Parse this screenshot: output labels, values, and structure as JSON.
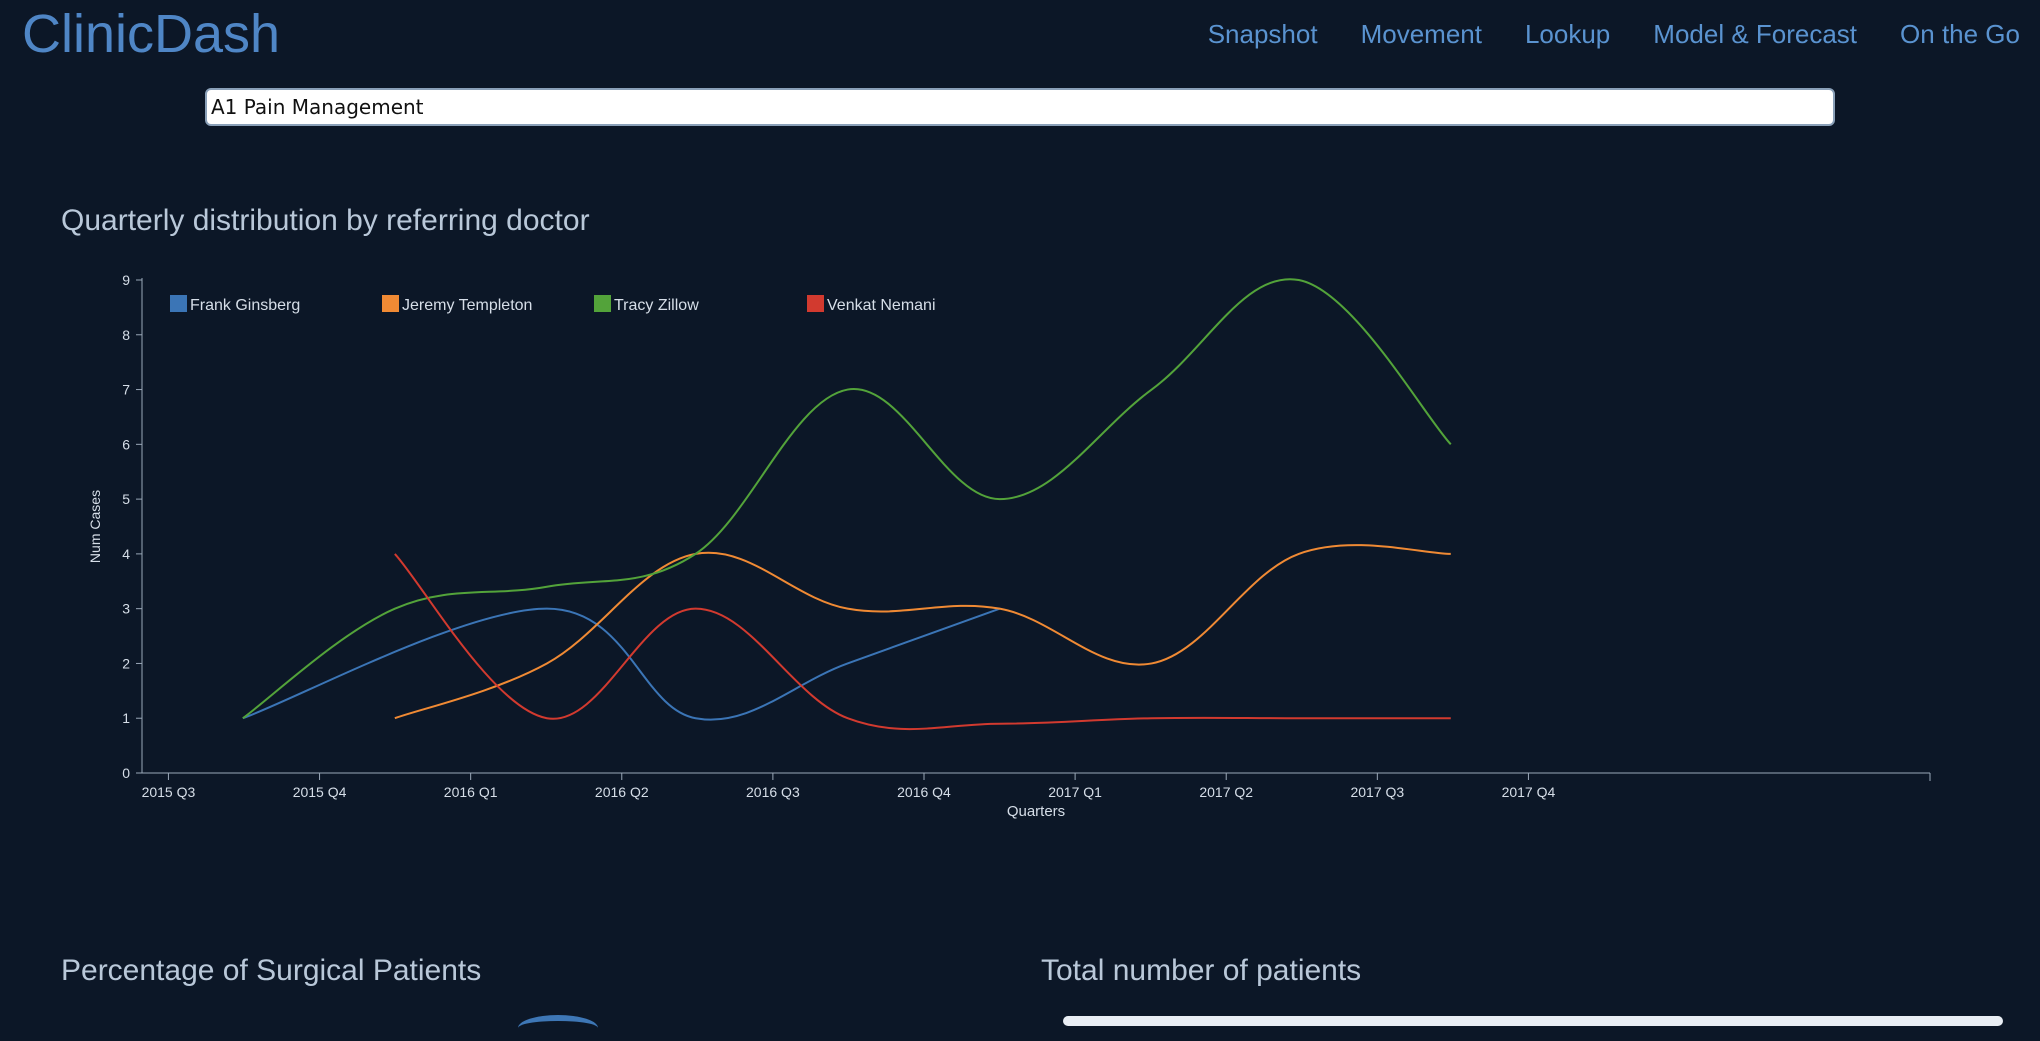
{
  "app": {
    "brand": "ClinicDash"
  },
  "nav": [
    {
      "label": "Snapshot"
    },
    {
      "label": "Movement"
    },
    {
      "label": "Lookup"
    },
    {
      "label": "Model & Forecast"
    },
    {
      "label": "On the Go"
    }
  ],
  "search": {
    "value": "A1 Pain Management"
  },
  "sections": {
    "chart_title": "Quarterly distribution by referring doctor",
    "surgical_title": "Percentage of Surgical Patients",
    "total_title": "Total number of patients"
  },
  "colors": {
    "background": "#0c1727",
    "brand": "#4f86c6",
    "series_blue": "#3b75b6",
    "series_orange": "#f08a34",
    "series_green": "#53a33a",
    "series_red": "#d23a2f"
  },
  "chart_data": {
    "type": "line",
    "title": "Quarterly distribution by referring doctor",
    "xlabel": "Quarters",
    "ylabel": "Num Cases",
    "ylim": [
      0,
      9
    ],
    "yticks": [
      0,
      1,
      2,
      3,
      4,
      5,
      6,
      7,
      8,
      9
    ],
    "xticks": [
      "2015 Q3",
      "2015 Q4",
      "2016 Q1",
      "2016 Q2",
      "2016 Q3",
      "2016 Q4",
      "2017 Q1",
      "2017 Q2",
      "2017 Q3",
      "2017 Q4"
    ],
    "legend_position": "top-left",
    "series": [
      {
        "name": "Frank Ginsberg",
        "color": "#3b75b6",
        "points": [
          [
            "2015-08-15",
            1
          ],
          [
            "2016-02-15",
            3
          ],
          [
            "2016-05-15",
            1
          ],
          [
            "2016-08-15",
            2
          ],
          [
            "2016-11-15",
            3
          ]
        ]
      },
      {
        "name": "Jeremy Templeton",
        "color": "#f08a34",
        "points": [
          [
            "2015-11-15",
            1
          ],
          [
            "2016-02-15",
            2
          ],
          [
            "2016-05-15",
            4
          ],
          [
            "2016-08-15",
            3
          ],
          [
            "2016-11-15",
            3
          ],
          [
            "2017-02-15",
            2
          ],
          [
            "2017-05-15",
            4
          ],
          [
            "2017-08-15",
            4
          ]
        ]
      },
      {
        "name": "Tracy Zillow",
        "color": "#53a33a",
        "points": [
          [
            "2015-08-15",
            1
          ],
          [
            "2015-11-15",
            3
          ],
          [
            "2016-02-15",
            3.4
          ],
          [
            "2016-05-15",
            4
          ],
          [
            "2016-08-15",
            7
          ],
          [
            "2016-11-15",
            5
          ],
          [
            "2017-02-15",
            7
          ],
          [
            "2017-05-15",
            9
          ],
          [
            "2017-08-15",
            6
          ]
        ]
      },
      {
        "name": "Venkat Nemani",
        "color": "#d23a2f",
        "points": [
          [
            "2015-11-15",
            4
          ],
          [
            "2016-02-15",
            1
          ],
          [
            "2016-05-15",
            3
          ],
          [
            "2016-08-15",
            1
          ],
          [
            "2016-11-15",
            0.9
          ],
          [
            "2017-02-15",
            1
          ],
          [
            "2017-05-15",
            1
          ],
          [
            "2017-08-15",
            1
          ]
        ]
      }
    ]
  }
}
